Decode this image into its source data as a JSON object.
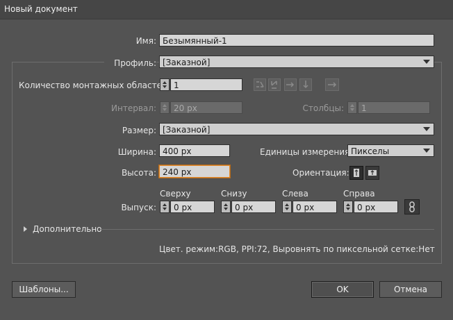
{
  "window": {
    "title": "Новый документ"
  },
  "name": {
    "label": "Имя:",
    "value": "Безымянный-1"
  },
  "profile": {
    "label": "Профиль:",
    "value": "[Заказной]"
  },
  "artboards": {
    "label": "Количество монтажных областей:",
    "value": "1"
  },
  "spacing": {
    "label": "Интервал:",
    "value": "20 px"
  },
  "columns": {
    "label": "Столбцы:",
    "value": "1"
  },
  "size": {
    "label": "Размер:",
    "value": "[Заказной]"
  },
  "width": {
    "label": "Ширина:",
    "value": "400 px"
  },
  "height": {
    "label": "Высота:",
    "value": "240 px"
  },
  "units": {
    "label": "Единицы измерения:",
    "value": "Пикселы"
  },
  "orientation": {
    "label": "Ориентация:"
  },
  "bleed": {
    "label": "Выпуск:",
    "top_label": "Сверху",
    "top_value": "0 px",
    "bottom_label": "Снизу",
    "bottom_value": "0 px",
    "left_label": "Слева",
    "left_value": "0 px",
    "right_label": "Справа",
    "right_value": "0 px"
  },
  "advanced": {
    "label": "Дополнительно"
  },
  "summary": "Цвет. режим:RGB, PPI:72, Выровнять по пиксельной сетке:Нет",
  "buttons": {
    "templates": "Шаблоны...",
    "ok": "OK",
    "cancel": "Отмена"
  }
}
